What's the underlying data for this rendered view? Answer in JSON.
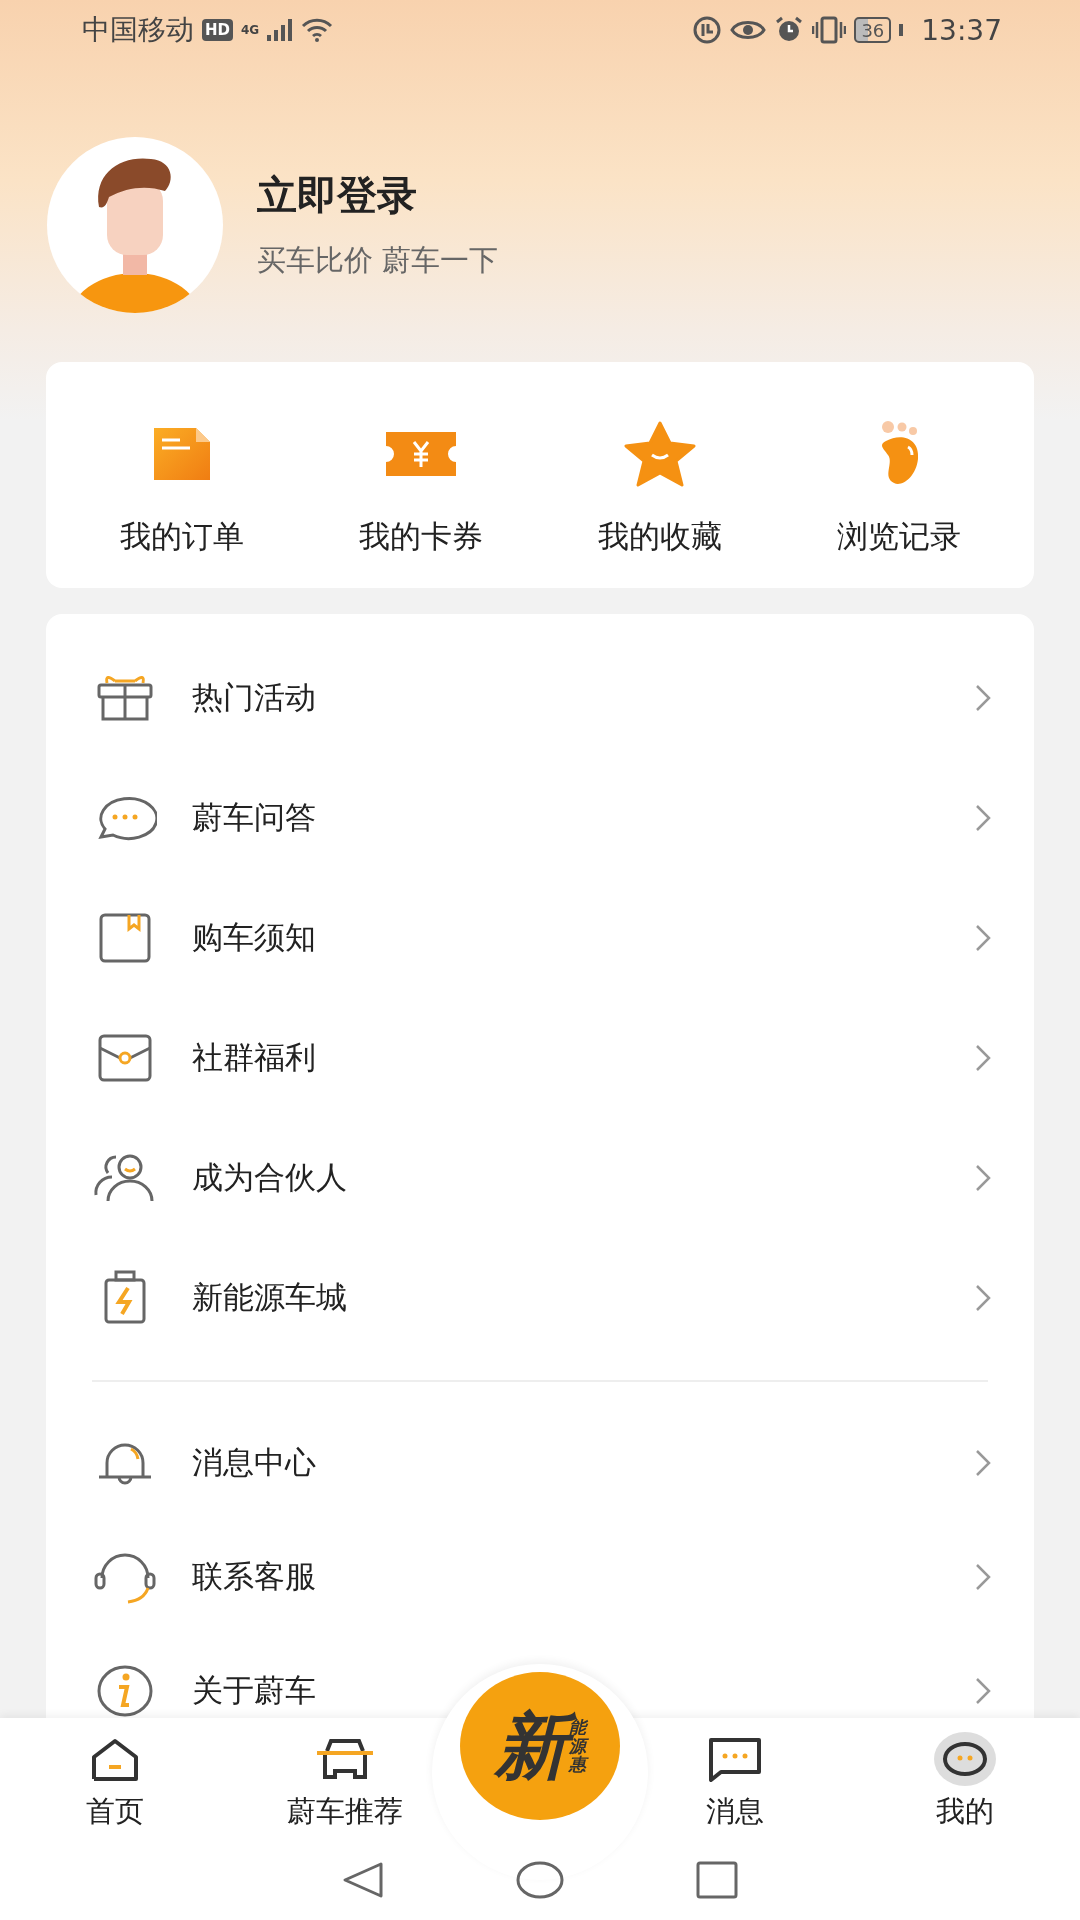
{
  "status_bar": {
    "carrier": "中国移动",
    "hd": "HD",
    "network": "4G",
    "battery": "36",
    "time": "13:37"
  },
  "profile": {
    "title": "立即登录",
    "subtitle": "买车比价 蔚车一下"
  },
  "quick_actions": [
    {
      "label": "我的订单"
    },
    {
      "label": "我的卡券"
    },
    {
      "label": "我的收藏"
    },
    {
      "label": "浏览记录"
    }
  ],
  "menu_groups": [
    [
      {
        "label": "热门活动"
      },
      {
        "label": "蔚车问答"
      },
      {
        "label": "购车须知"
      },
      {
        "label": "社群福利"
      },
      {
        "label": "成为合伙人"
      },
      {
        "label": "新能源车城"
      }
    ],
    [
      {
        "label": "消息中心"
      },
      {
        "label": "联系客服"
      },
      {
        "label": "关于蔚车"
      }
    ]
  ],
  "tab_bar": {
    "tabs": [
      {
        "label": "首页",
        "selected": false
      },
      {
        "label": "蔚车推荐",
        "selected": false
      },
      {
        "label": "消息",
        "selected": false
      },
      {
        "label": "我的",
        "selected": true
      }
    ],
    "center_badge": {
      "main": "新",
      "side": "能源惠"
    }
  }
}
